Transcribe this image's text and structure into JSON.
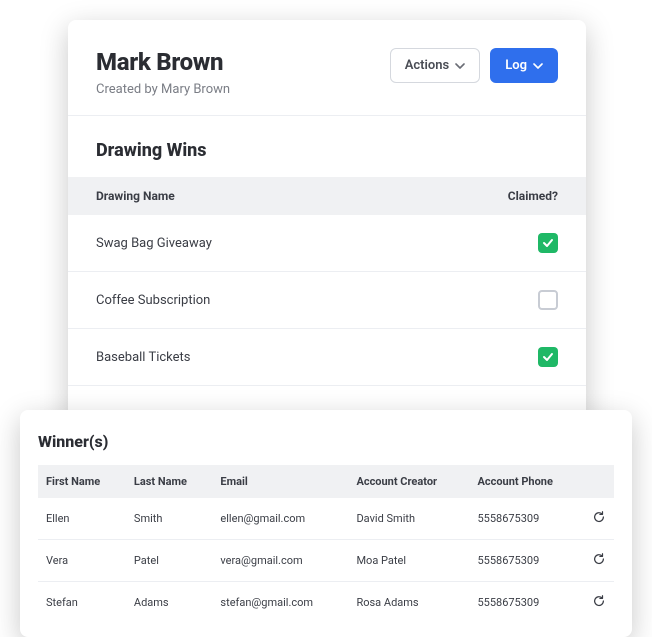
{
  "header": {
    "name": "Mark Brown",
    "created_by": "Created by Mary Brown",
    "actions_label": "Actions",
    "log_label": "Log"
  },
  "drawing_wins": {
    "title": "Drawing Wins",
    "col_name": "Drawing Name",
    "col_claimed": "Claimed?",
    "rows": [
      {
        "name": "Swag Bag Giveaway",
        "claimed": true
      },
      {
        "name": "Coffee Subscription",
        "claimed": false
      },
      {
        "name": "Baseball Tickets",
        "claimed": true
      }
    ]
  },
  "winners": {
    "title": "Winner(s)",
    "cols": {
      "first_name": "First Name",
      "last_name": "Last Name",
      "email": "Email",
      "account_creator": "Account Creator",
      "account_phone": "Account Phone"
    },
    "rows": [
      {
        "first_name": "Ellen",
        "last_name": "Smith",
        "email": "ellen@gmail.com",
        "creator": "David Smith",
        "phone": "5558675309"
      },
      {
        "first_name": "Vera",
        "last_name": "Patel",
        "email": "vera@gmail.com",
        "creator": "Moa Patel",
        "phone": "5558675309"
      },
      {
        "first_name": "Stefan",
        "last_name": "Adams",
        "email": "stefan@gmail.com",
        "creator": "Rosa Adams",
        "phone": "5558675309"
      }
    ]
  }
}
